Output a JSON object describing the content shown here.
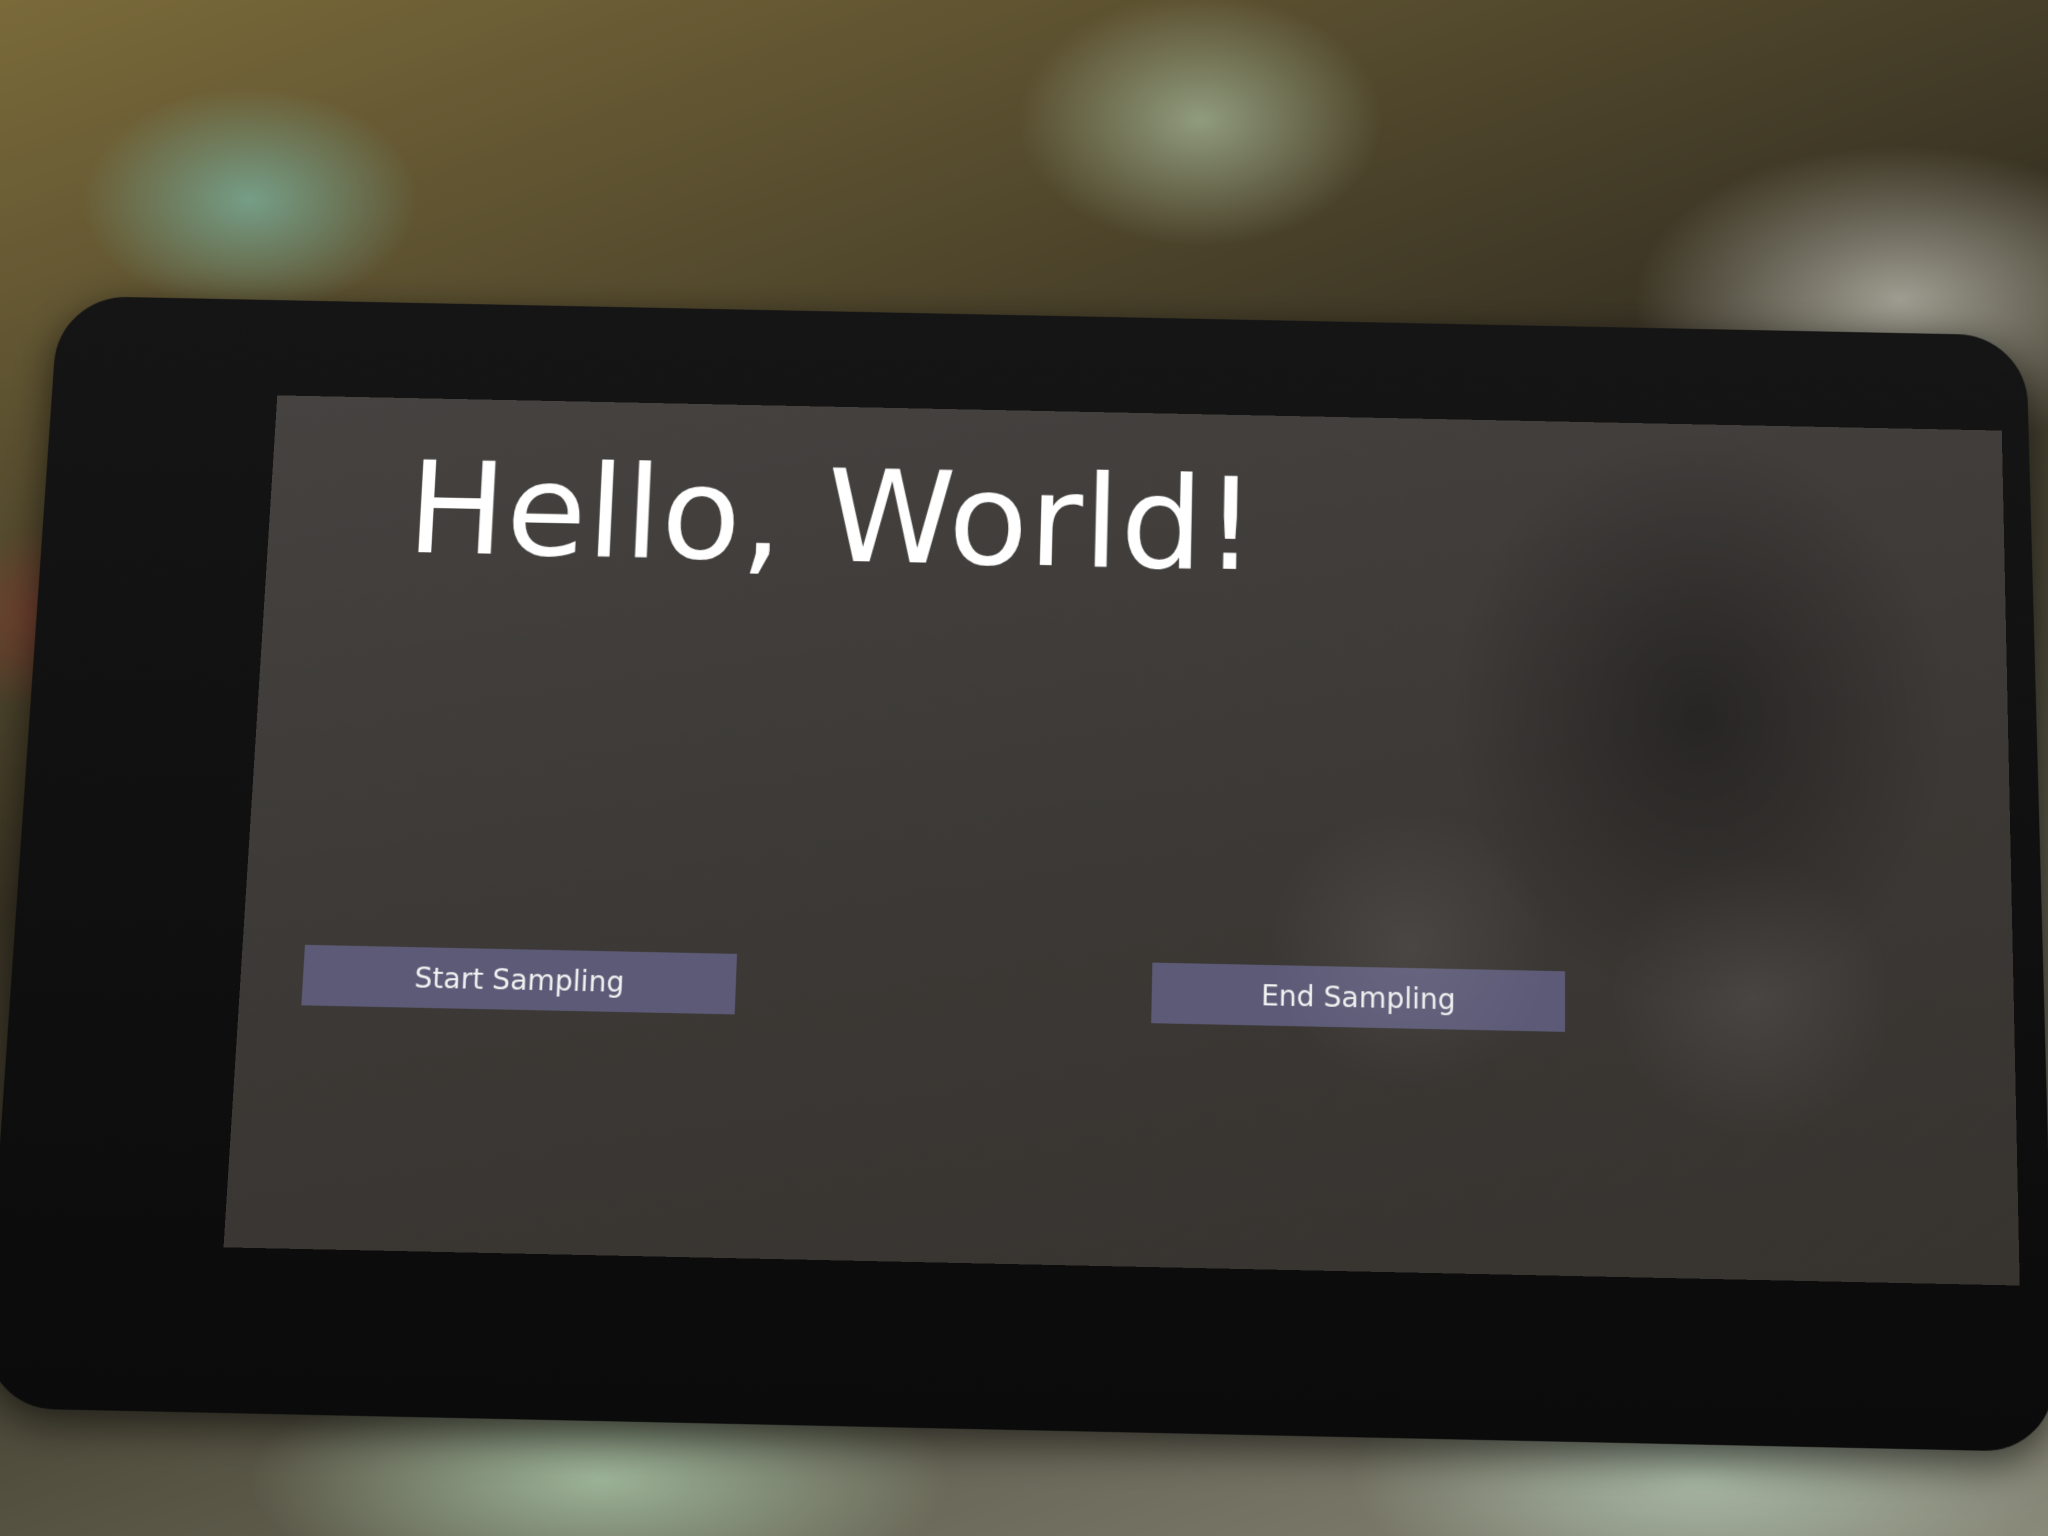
{
  "app": {
    "title": "Hello, World!"
  },
  "controls": {
    "start_label": "Start Sampling",
    "end_label": "End Sampling"
  },
  "colors": {
    "screen_background": "#3c3936",
    "button_background": "#5d5a77",
    "title_text": "#ffffff",
    "device_bezel": "#111111"
  }
}
